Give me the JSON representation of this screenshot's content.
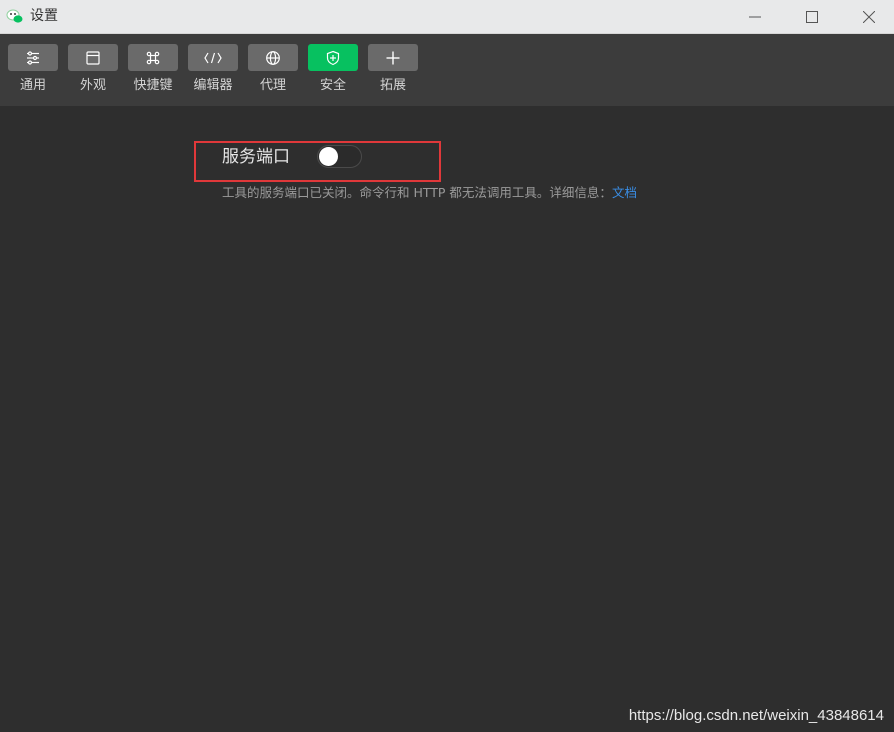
{
  "window": {
    "title": "设置"
  },
  "toolbar": {
    "items": [
      {
        "label": "通用",
        "icon": "sliders-icon"
      },
      {
        "label": "外观",
        "icon": "window-icon"
      },
      {
        "label": "快捷键",
        "icon": "command-key-icon"
      },
      {
        "label": "编辑器",
        "icon": "code-icon"
      },
      {
        "label": "代理",
        "icon": "globe-icon"
      },
      {
        "label": "安全",
        "icon": "shield-icon",
        "active": true
      },
      {
        "label": "拓展",
        "icon": "plus-icon"
      }
    ]
  },
  "security": {
    "service_port_label": "服务端口",
    "service_port_enabled": false,
    "description": "工具的服务端口已关闭。命令行和 HTTP 都无法调用工具。详细信息：",
    "doc_link": "文档"
  },
  "watermark": "https://blog.csdn.net/weixin_43848614",
  "colors": {
    "accent": "#07c160",
    "highlight_border": "#e0383a",
    "link": "#3a8ee6"
  }
}
